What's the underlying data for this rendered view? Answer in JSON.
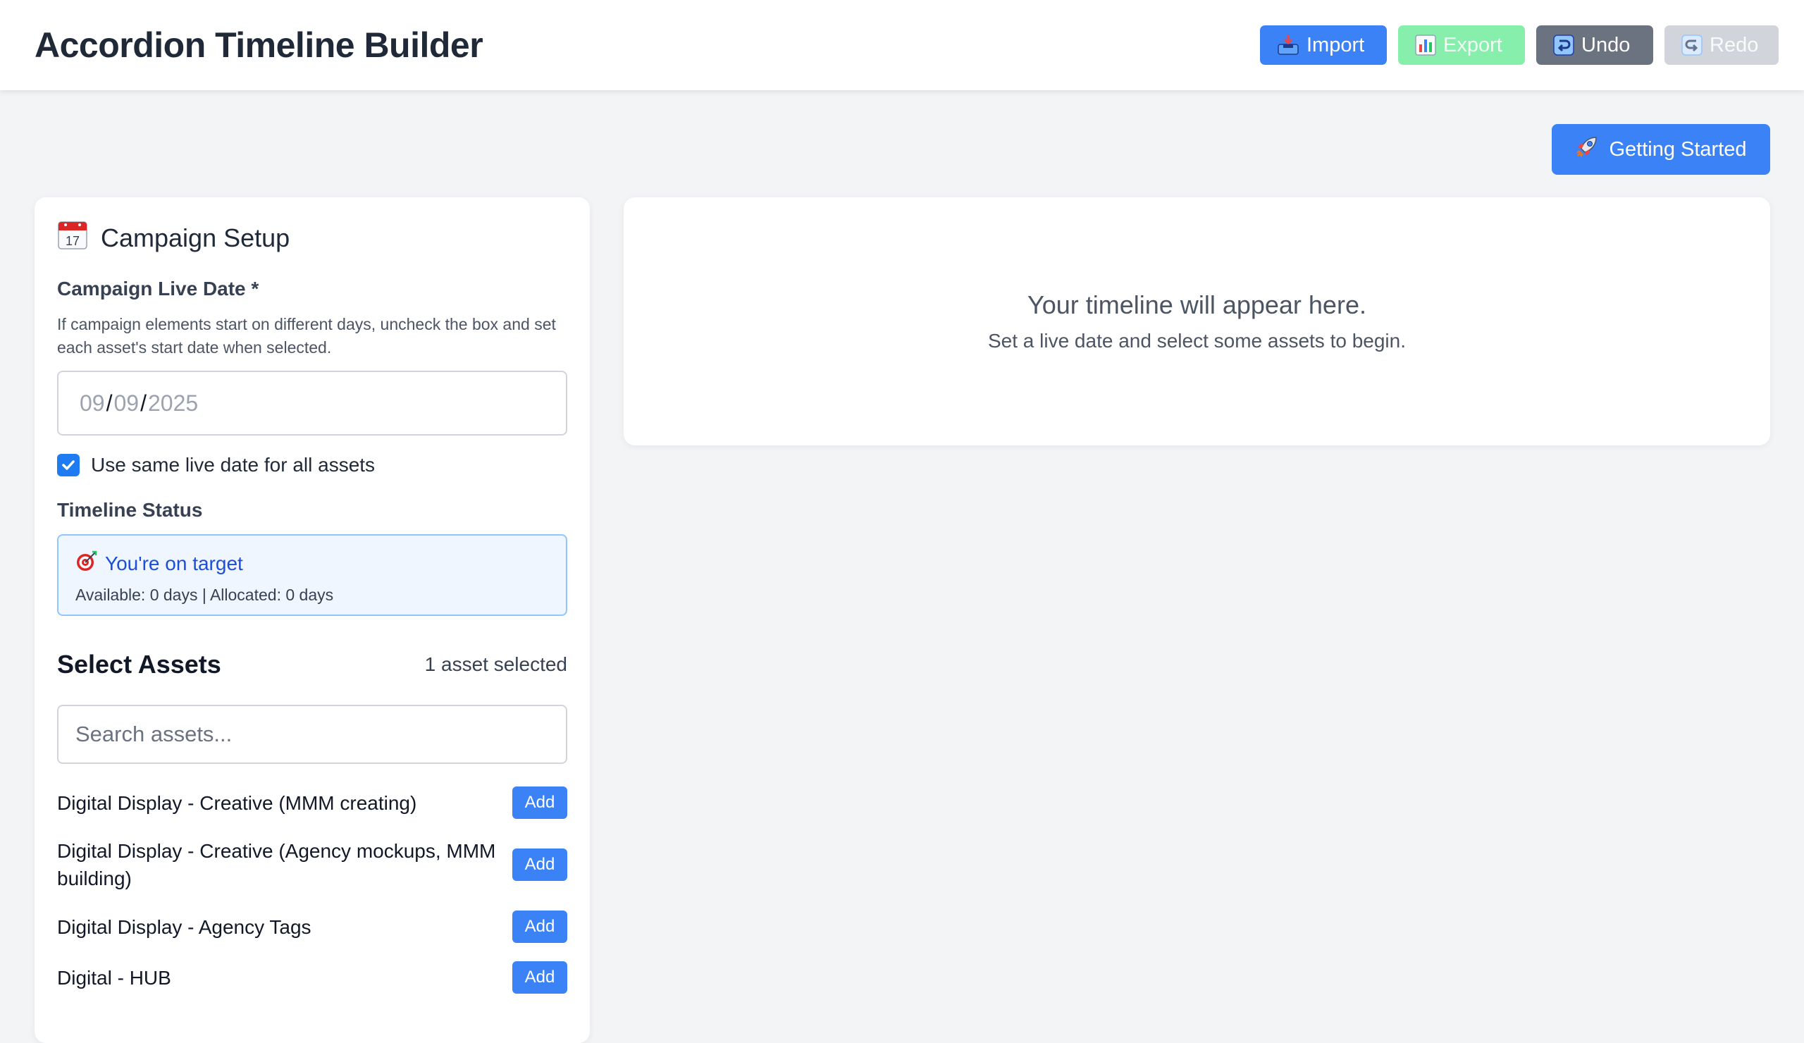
{
  "app": {
    "title": "Accordion Timeline Builder"
  },
  "toolbar": {
    "import_label": "Import",
    "export_label": "Export",
    "undo_label": "Undo",
    "redo_label": "Redo"
  },
  "getting_started": {
    "label": "Getting Started",
    "icon": "rocket-icon"
  },
  "campaign_setup": {
    "title": "Campaign Setup",
    "icon": "calendar-icon",
    "live_date_label": "Campaign Live Date *",
    "help_text": "If campaign elements start on different days, uncheck the box and set each asset's start date when selected.",
    "date": {
      "month": "09",
      "day": "09",
      "year": "2025",
      "separator": "/"
    },
    "same_date_checkbox": {
      "label": "Use same live date for all assets",
      "checked": true
    }
  },
  "timeline_status": {
    "label": "Timeline Status",
    "headline": "You're on target",
    "details": "Available: 0 days | Allocated: 0 days"
  },
  "assets": {
    "title": "Select Assets",
    "count_text": "1 asset selected",
    "search_placeholder": "Search assets...",
    "items": [
      {
        "name": "Digital Display - Creative (MMM creating)",
        "action": "Add"
      },
      {
        "name": "Digital Display - Creative (Agency mockups, MMM building)",
        "action": "Add"
      },
      {
        "name": "Digital Display - Agency Tags",
        "action": "Add"
      },
      {
        "name": "Digital - HUB",
        "action": "Add"
      }
    ]
  },
  "timeline": {
    "empty_title": "Your timeline will appear here.",
    "empty_subtitle": "Set a live date and select some assets to begin."
  },
  "colors": {
    "primary": "#3b82f6",
    "export_disabled": "#86efac",
    "undo": "#6b7280",
    "redo_disabled": "#d1d5db",
    "status_bg": "#eff6ff",
    "status_border": "#93c5fd",
    "status_text": "#1d4ed8"
  }
}
